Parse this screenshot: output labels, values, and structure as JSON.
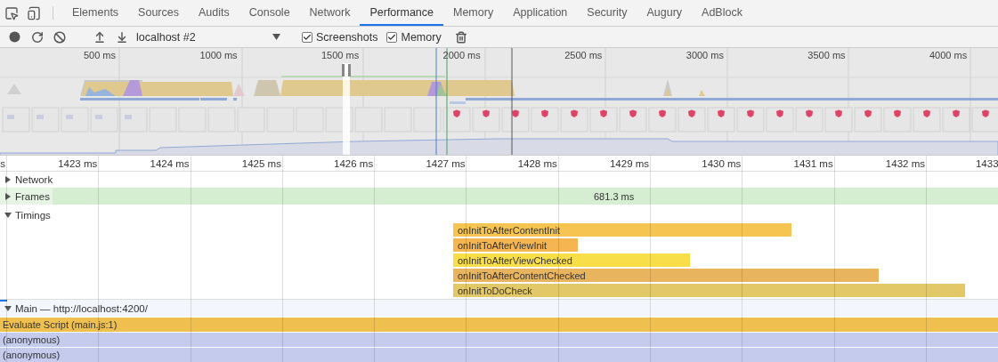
{
  "tabs": [
    {
      "label": "Elements",
      "selected": false
    },
    {
      "label": "Sources",
      "selected": false
    },
    {
      "label": "Audits",
      "selected": false
    },
    {
      "label": "Console",
      "selected": false
    },
    {
      "label": "Network",
      "selected": false
    },
    {
      "label": "Performance",
      "selected": true
    },
    {
      "label": "Memory",
      "selected": false
    },
    {
      "label": "Application",
      "selected": false
    },
    {
      "label": "Security",
      "selected": false
    },
    {
      "label": "Augury",
      "selected": false
    },
    {
      "label": "AdBlock",
      "selected": false
    }
  ],
  "toolbar": {
    "profile_select": {
      "value": "localhost #2"
    },
    "checkboxes": [
      {
        "label": "Screenshots",
        "checked": true
      },
      {
        "label": "Memory",
        "checked": true
      }
    ]
  },
  "overview": {
    "ticks": [
      "500 ms",
      "1000 ms",
      "1500 ms",
      "2000 ms",
      "2500 ms",
      "3000 ms",
      "3500 ms",
      "4000 ms"
    ]
  },
  "ruler": {
    "ticks": [
      "s",
      "1423 ms",
      "1424 ms",
      "1425 ms",
      "1426 ms",
      "1427 ms",
      "1428 ms",
      "1429 ms",
      "1430 ms",
      "1431 ms",
      "1432 ms",
      "1433"
    ]
  },
  "tracks": [
    {
      "label": "Network",
      "expanded": false,
      "kind": "plain"
    },
    {
      "label": "Frames",
      "expanded": false,
      "kind": "frames",
      "reading": "681.3 ms"
    },
    {
      "label": "Timings",
      "expanded": true,
      "kind": "timings",
      "bars": [
        {
          "label": "onInitToAfterContentInit",
          "color": "#f5c451"
        },
        {
          "label": "onInitToAfterViewInit",
          "color": "#f5b550"
        },
        {
          "label": "onInitToAfterViewChecked",
          "color": "#f8de48"
        },
        {
          "label": "onInitToAfterContentChecked",
          "color": "#e8b45e"
        },
        {
          "label": "onInitToDoCheck",
          "color": "#e2c866"
        }
      ]
    }
  ],
  "main": {
    "title": "Main — http://localhost:4200/",
    "expanded": true,
    "events": [
      {
        "label": "Evaluate Script (main.js:1)",
        "color": "#efc050"
      },
      {
        "label": "(anonymous)",
        "color": "#c5cbed"
      },
      {
        "label": "(anonymous)",
        "color": "#c5cbed"
      }
    ]
  }
}
